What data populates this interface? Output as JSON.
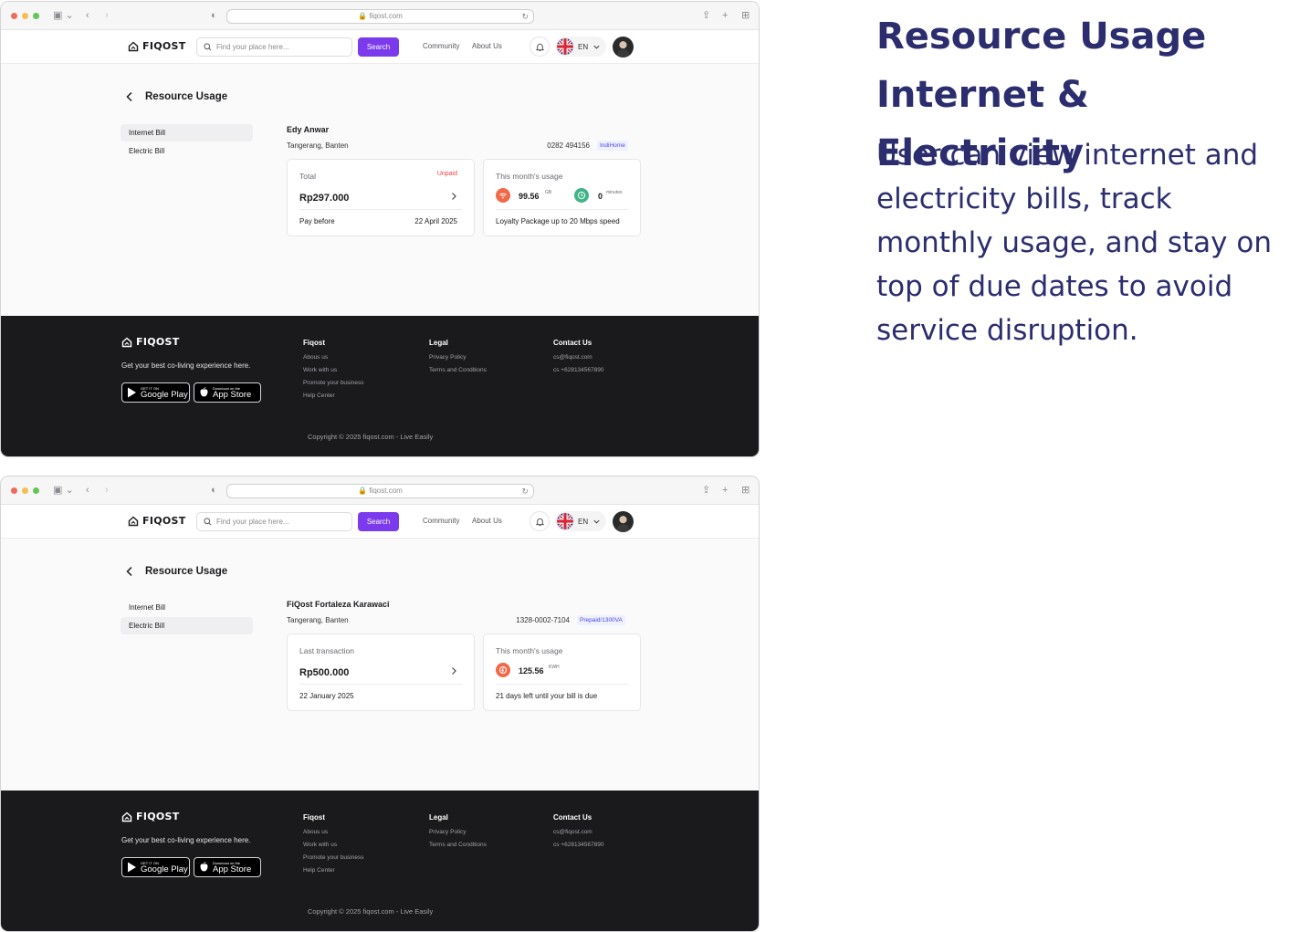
{
  "headline": {
    "line1": "Resource Usage",
    "line2": "Internet & Electricity",
    "description": "User can view internet and electricity bills, track monthly usage, and stay on top of due dates to avoid service disruption."
  },
  "browser": {
    "url": "fiqost.com"
  },
  "nav": {
    "logo": "FIQOST",
    "search_placeholder": "Find your place here...",
    "search_button": "Search",
    "links": [
      "Community",
      "About Us"
    ],
    "language": "EN"
  },
  "page": {
    "title": "Resource Usage",
    "sidebar": [
      "Internet Bill",
      "Electric Bill"
    ]
  },
  "screens": [
    {
      "active_tab": "Internet Bill",
      "customer": {
        "name": "Edy Anwar",
        "city": "Tangerang, Banten",
        "id": "0282 494156",
        "provider": "IndiHome"
      },
      "bill": {
        "label": "Total",
        "status": "Unpaid",
        "amount": "Rp297.000",
        "foot_left": "Pay before",
        "foot_right": "22 April 2025"
      },
      "usage": {
        "label": "This month's usage",
        "metrics": [
          {
            "icon": "wifi-icon",
            "value": "99.56",
            "unit": "GB",
            "color": "#f06a4a"
          },
          {
            "icon": "clock-icon",
            "value": "0",
            "unit": "minutes",
            "color": "#3fb489"
          }
        ],
        "note": "Loyalty Package up to 20 Mbps speed"
      }
    },
    {
      "active_tab": "Electric Bill",
      "customer": {
        "name": "FiQost Fortaleza Karawaci",
        "city": "Tangerang, Banten",
        "id": "1328-0002-7104",
        "provider": "Prepaid/1300VA"
      },
      "bill": {
        "label": "Last transaction",
        "status": "",
        "amount": "Rp500.000",
        "foot_left": "22 January 2025",
        "foot_right": ""
      },
      "usage": {
        "label": "This month's usage",
        "metrics": [
          {
            "icon": "electricity-icon",
            "value": "125.56",
            "unit": "KWH",
            "color": "#f06a4a"
          }
        ],
        "note": "21 days left until your bill is due"
      }
    }
  ],
  "footer": {
    "logo": "FIQOST",
    "tagline": "Get your best co-living experience here.",
    "google_play": {
      "small": "GET IT ON",
      "big": "Google Play"
    },
    "app_store": {
      "small": "Download on the",
      "big": "App Store"
    },
    "columns": [
      {
        "title": "Fiqost",
        "links": [
          "Abous us",
          "Work with us",
          "Promote your business",
          "Help Center"
        ]
      },
      {
        "title": "Legal",
        "links": [
          "Privacy Policy",
          "Terms and Conditions"
        ]
      },
      {
        "title": "Contact Us",
        "links": [
          "cs@fiqost.com",
          "cs +628134567890"
        ]
      }
    ],
    "copyright": "Copyright © 2025 fiqost.com - Live Easily"
  },
  "colors": {
    "accent": "#7c3aed",
    "headline": "#2c2d6e",
    "footer_bg": "#1a1a1c",
    "unpaid": "#ef4444"
  }
}
